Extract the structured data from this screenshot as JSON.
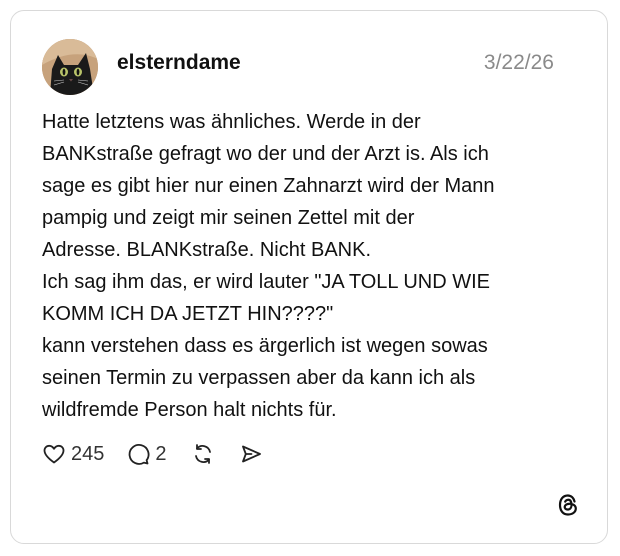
{
  "post": {
    "username": "elsterndame",
    "date": "3/22/26",
    "avatar_icon": "cat-avatar",
    "text_lines": [
      "Hatte letztens was ähnliches. Werde in der",
      "BANKstraße gefragt wo der und der Arzt is. Als ich",
      "sage es gibt hier nur einen Zahnarzt wird der Mann",
      "pampig und zeigt mir seinen Zettel mit der",
      "Adresse. BLANKstraße. Nicht BANK.",
      "Ich sag ihm das, er wird lauter \"JA TOLL UND WIE",
      "KOMM ICH DA JETZT HIN????\"",
      "kann verstehen dass es ärgerlich ist wegen sowas",
      "seinen Termin zu verpassen aber da kann ich als",
      "wildfremde Person halt nichts für."
    ]
  },
  "actions": {
    "likes": "245",
    "replies": "2",
    "icons": [
      "heart-icon",
      "reply-icon",
      "repost-icon",
      "share-icon"
    ]
  },
  "brand": {
    "logo_icon": "threads-logo",
    "text_color": "#111111",
    "date_color": "#8a8a8a"
  }
}
